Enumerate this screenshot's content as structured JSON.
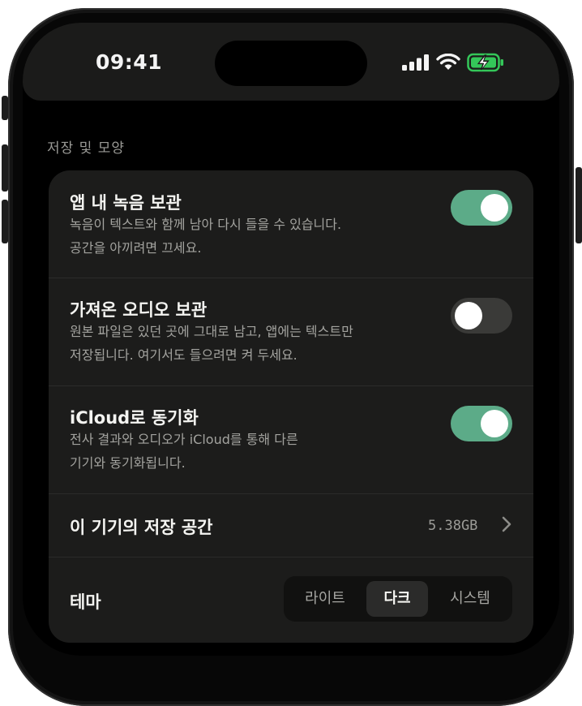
{
  "status_bar": {
    "time": "09:41",
    "icons": [
      "cellular-signal-icon",
      "wifi-icon",
      "battery-charging-icon"
    ],
    "battery_color": "#34c759"
  },
  "section_title": "저장 및 모양",
  "settings": {
    "keep_recordings": {
      "title": "앱 내 녹음 보관",
      "desc_line1": "녹음이 텍스트와 함께 남아 다시 들을 수 있습니다.",
      "desc_line2": "공간을 아끼려면 끄세요.",
      "enabled": true
    },
    "keep_imported_audio": {
      "title": "가져온 오디오 보관",
      "desc_line1": "원본 파일은 있던 곳에 그대로 남고, 앱에는 텍스트만",
      "desc_line2": "저장됩니다. 여기서도 들으려면 켜 두세요.",
      "enabled": false
    },
    "icloud_sync": {
      "title": "iCloud로 동기화",
      "desc_line1": "전사 결과와 오디오가 iCloud를 통해 다른",
      "desc_line2": "기기와 동기화됩니다.",
      "enabled": true
    },
    "storage": {
      "label": "이 기기의 저장 공간",
      "value": "5.38GB"
    },
    "theme": {
      "label": "테마",
      "options": [
        "라이트",
        "다크",
        "시스템"
      ],
      "selected": "다크"
    }
  },
  "colors": {
    "accent": "#5cab88",
    "card_background": "#1c1c1b",
    "screen_background": "#000000"
  }
}
